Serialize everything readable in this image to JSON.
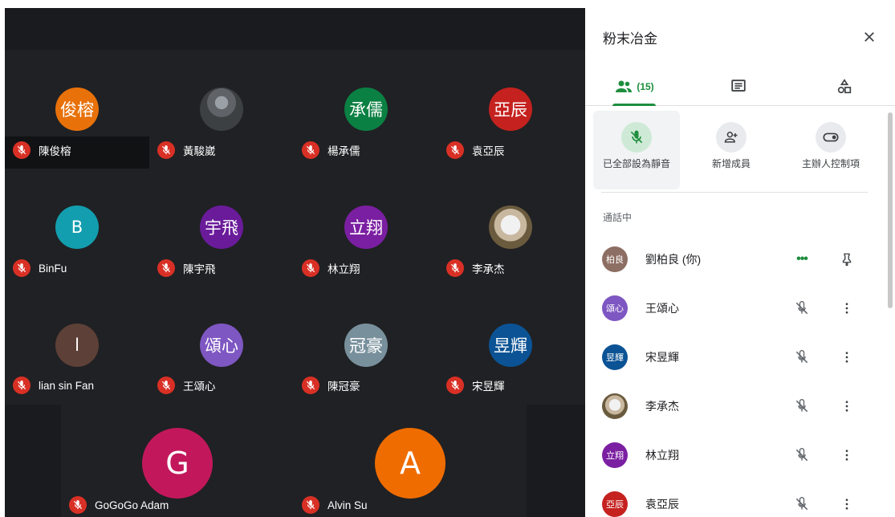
{
  "grid": {
    "tiles": [
      {
        "name": "陳俊榕",
        "initials": "俊榕",
        "color": "#e8710a"
      },
      {
        "name": "黃駿崴",
        "initials": "",
        "color": "photo-person"
      },
      {
        "name": "楊承儒",
        "initials": "承儒",
        "color": "#0b8043"
      },
      {
        "name": "袁亞辰",
        "initials": "亞辰",
        "color": "#c5221f"
      },
      {
        "name": "BinFu",
        "initials": "B",
        "color": "#129eaf"
      },
      {
        "name": "陳宇飛",
        "initials": "宇飛",
        "color": "#6a1b9a"
      },
      {
        "name": "林立翔",
        "initials": "立翔",
        "color": "#7b1fa2"
      },
      {
        "name": "李承杰",
        "initials": "",
        "color": "photo-dog"
      },
      {
        "name": "lian sin Fan",
        "initials": "l",
        "color": "#5d4037"
      },
      {
        "name": "王頌心",
        "initials": "頌心",
        "color": "#7e57c2"
      },
      {
        "name": "陳冠豪",
        "initials": "冠豪",
        "color": "#78909c"
      },
      {
        "name": "宋昱輝",
        "initials": "昱輝",
        "color": "#0b5394"
      },
      {
        "name": "GoGoGo Adam",
        "initials": "G",
        "color": "#c2185b"
      },
      {
        "name": "Alvin Su",
        "initials": "A",
        "color": "#ef6c00"
      }
    ]
  },
  "panel": {
    "title": "粉末冶金",
    "people_count": "(15)",
    "actions": {
      "mute_all": "已全部設為靜音",
      "add_member": "新增成員",
      "host_controls": "主辦人控制項"
    },
    "section_label": "通話中",
    "participants": [
      {
        "name": "劉柏良 (你)",
        "initials": "柏良",
        "color": "#8d6e63"
      },
      {
        "name": "王頌心",
        "initials": "頌心",
        "color": "#7e57c2"
      },
      {
        "name": "宋昱輝",
        "initials": "昱輝",
        "color": "#0b5394"
      },
      {
        "name": "李承杰",
        "initials": "",
        "color": "photo-dog"
      },
      {
        "name": "林立翔",
        "initials": "立翔",
        "color": "#7b1fa2"
      },
      {
        "name": "袁亞辰",
        "initials": "亞辰",
        "color": "#c5221f"
      }
    ]
  }
}
